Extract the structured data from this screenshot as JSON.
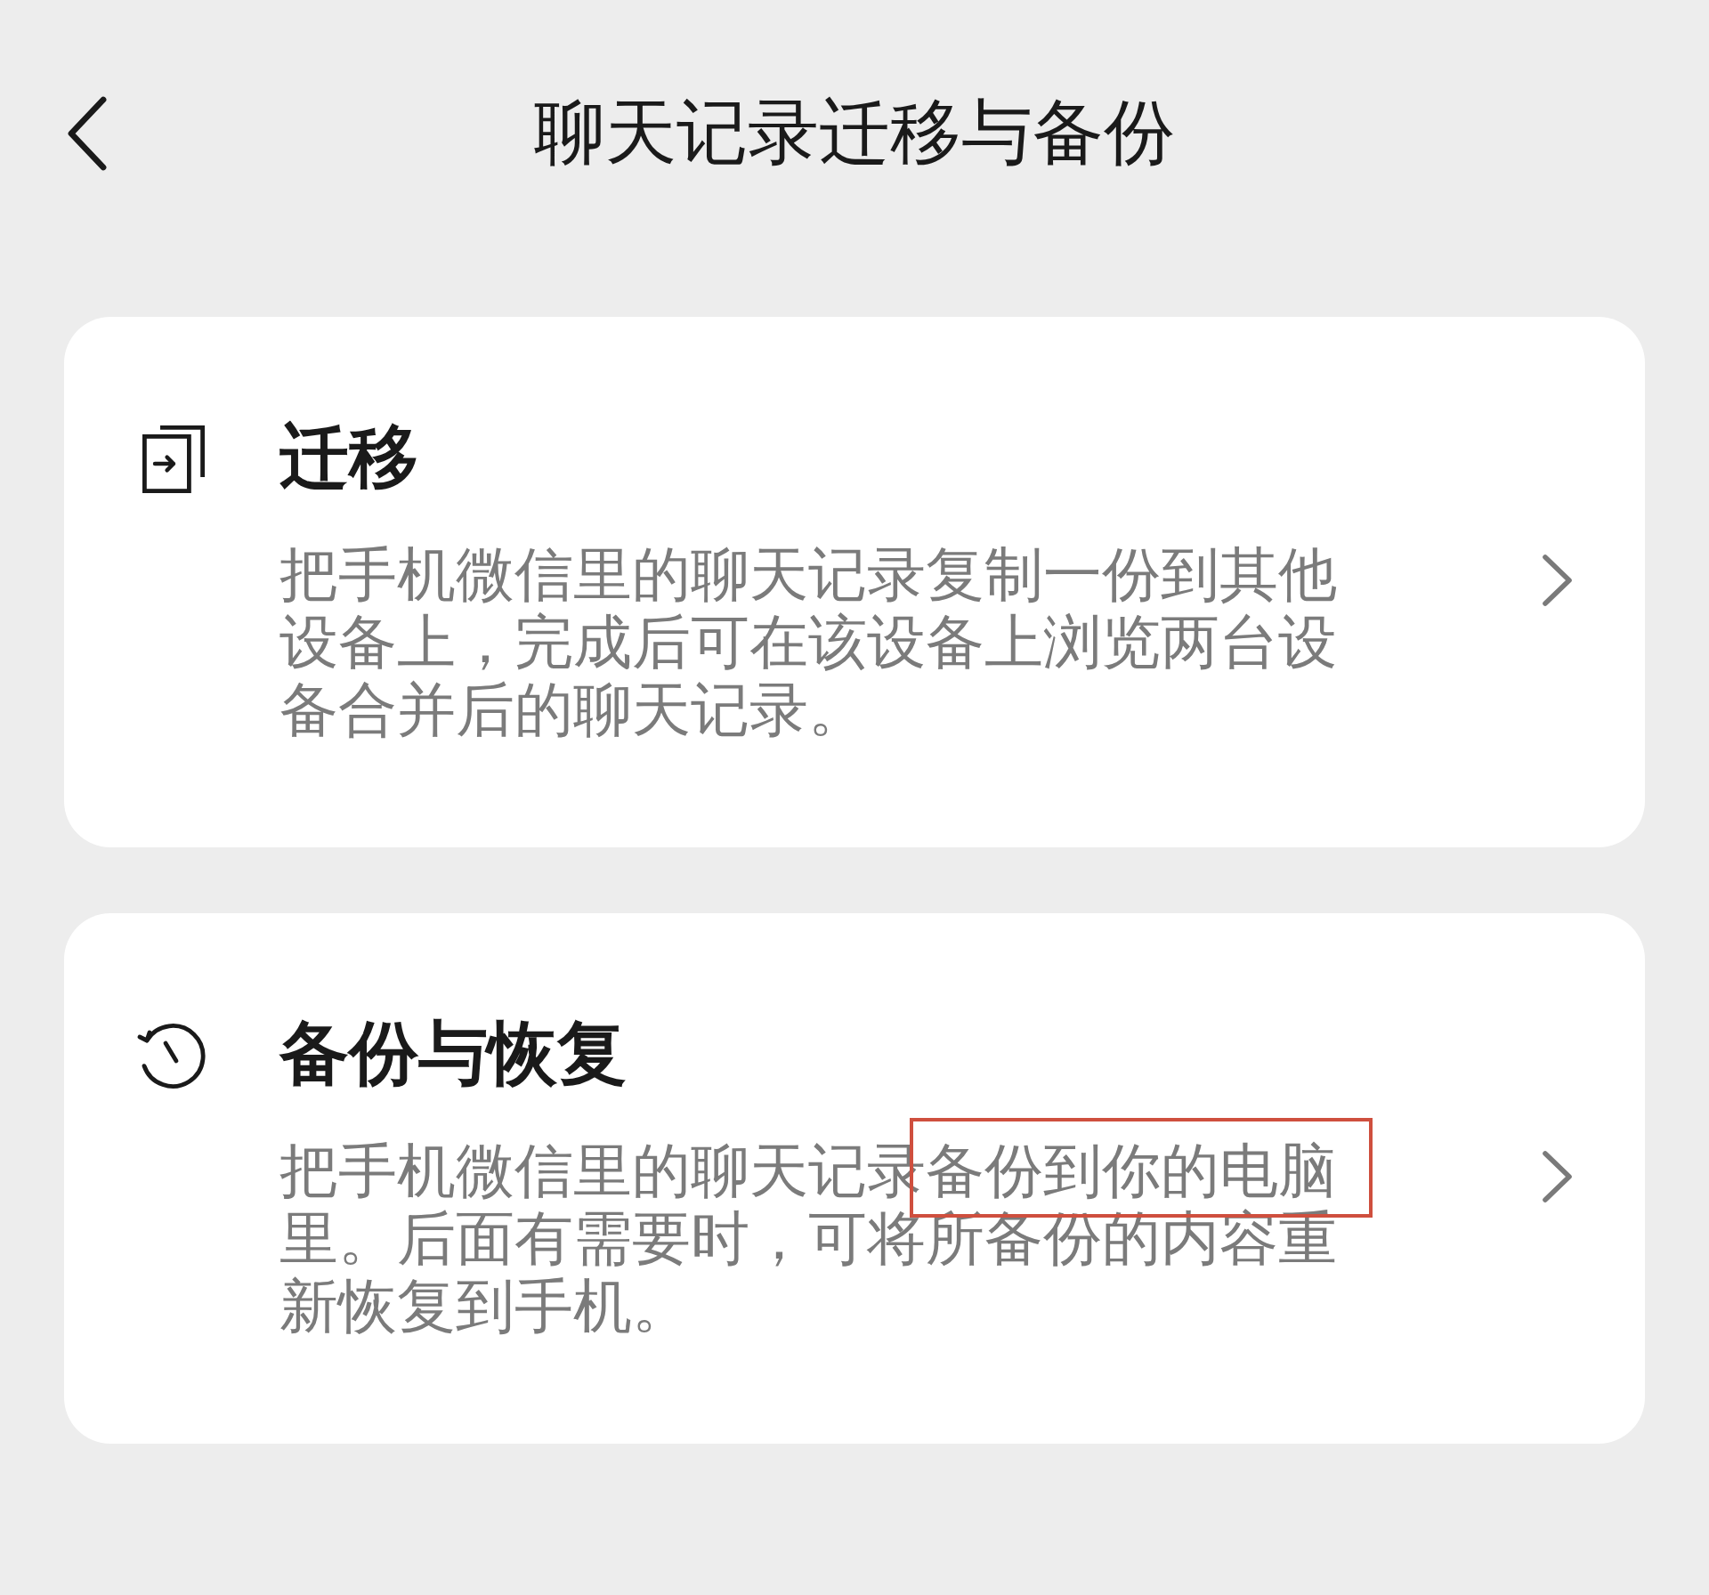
{
  "header": {
    "title": "聊天记录迁移与备份"
  },
  "cards": [
    {
      "kind": "migrate",
      "title": "迁移",
      "description": [
        {
          "text": "把手机微信里的聊天记录复制一份到其他设备上，完成后可在该设备上浏览两台设备合并后的聊天记录。",
          "highlighted": false
        }
      ]
    },
    {
      "kind": "backup",
      "title": "备份与恢复",
      "description": [
        {
          "text": "把手机微信里的聊天记录",
          "highlighted": false
        },
        {
          "text": "备份到你的电脑",
          "highlighted": true
        },
        {
          "text": "里。后面有需要时，可将所备份的内容重新恢复到手机。",
          "highlighted": false
        }
      ]
    }
  ]
}
